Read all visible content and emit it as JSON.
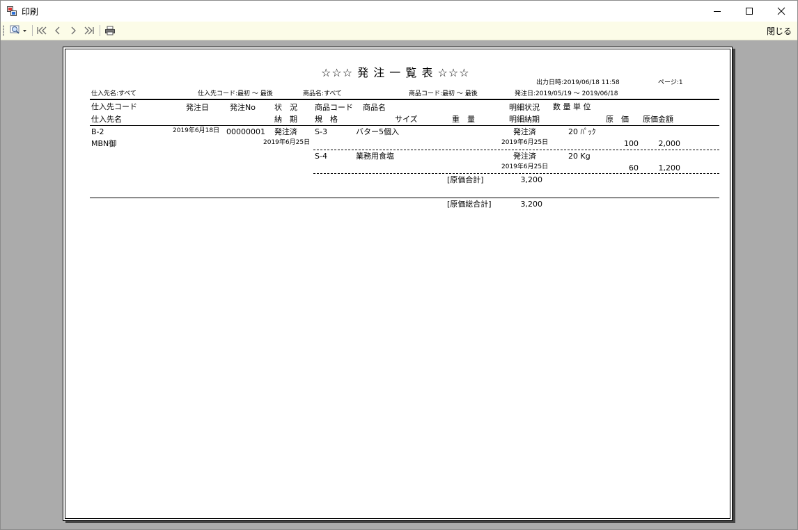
{
  "window": {
    "title": "印刷",
    "controls": {
      "minimize": "—",
      "maximize": "☐",
      "close": "✕"
    }
  },
  "toolbar": {
    "zoom_icon": "magnifier-icon",
    "first_icon": "first-page-icon",
    "prev_icon": "previous-page-icon",
    "next_icon": "next-page-icon",
    "last_icon": "last-page-icon",
    "print_icon": "printer-icon",
    "close_label": "閉じる"
  },
  "report": {
    "title": "☆☆☆ 発 注 一 覧 表 ☆☆☆",
    "output_datetime": "出力日時:2019/06/18 11:58",
    "page": "ページ:1",
    "filters": {
      "supplier_name": "仕入先名:すべて",
      "supplier_code": "仕入先コード:最初 ～ 最後",
      "product_name": "商品名:すべて",
      "product_code": "商品コード:最初 ～ 最後",
      "order_date": "発注日:2019/05/19 ～ 2019/06/18"
    },
    "headers": {
      "supplier_code": "仕入先コード",
      "order_date": "発注日",
      "order_no": "発注No",
      "status": "状　況",
      "product_code": "商品コード",
      "product_name": "商品名",
      "line_status": "明細状況",
      "qty_unit": "数 量 単 位",
      "supplier_name": "仕入先名",
      "delivery": "納　期",
      "spec": "規　格",
      "size": "サイズ",
      "weight": "重　量",
      "line_delivery": "明細納期",
      "cost": "原　価",
      "cost_amount": "原価金額"
    },
    "order": {
      "supplier_code": "B-2",
      "supplier_name": "MBN御",
      "order_date": "2019年6月18日",
      "order_no": "00000001",
      "status": "発注済",
      "delivery": "2019年6月25日"
    },
    "lines": [
      {
        "product_code": "S-3",
        "product_name": "バター5個入",
        "line_status": "発注済",
        "qty_unit": "20 ﾊﾟｯｸ",
        "line_delivery": "2019年6月25日",
        "cost": "100",
        "cost_amount": "2,000"
      },
      {
        "product_code": "S-4",
        "product_name": "業務用食塩",
        "line_status": "発注済",
        "qty_unit": "20 Kg",
        "line_delivery": "2019年6月25日",
        "cost": "60",
        "cost_amount": "1,200"
      }
    ],
    "subtotal_label": "[原価合計]",
    "subtotal_value": "3,200",
    "grand_total_label": "[原価総合計]",
    "grand_total_value": "3,200"
  }
}
